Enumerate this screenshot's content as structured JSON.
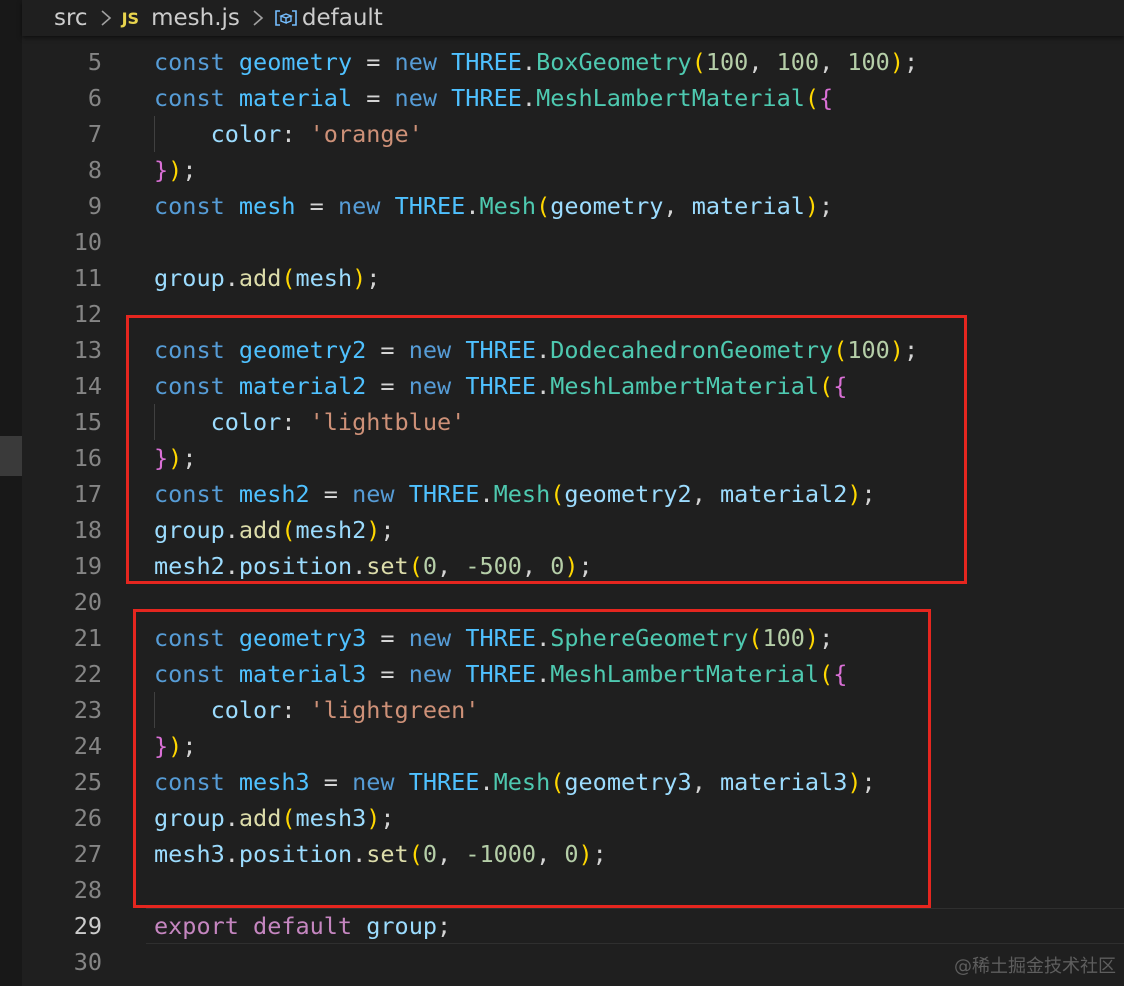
{
  "breadcrumb": {
    "folder": "src",
    "file_badge": "JS",
    "file": "mesh.js",
    "symbol": "default"
  },
  "editor": {
    "lines": [
      {
        "n": "5",
        "parts": [
          [
            "kw",
            "const"
          ],
          [
            "pun",
            " "
          ],
          [
            "var",
            "geometry"
          ],
          [
            "pun",
            " = "
          ],
          [
            "kw",
            "new"
          ],
          [
            "pun",
            " "
          ],
          [
            "var",
            "THREE"
          ],
          [
            "pun",
            "."
          ],
          [
            "cls",
            "BoxGeometry"
          ],
          [
            "b1",
            "("
          ],
          [
            "num",
            "100"
          ],
          [
            "pun",
            ", "
          ],
          [
            "num",
            "100"
          ],
          [
            "pun",
            ", "
          ],
          [
            "num",
            "100"
          ],
          [
            "b1",
            ")"
          ],
          [
            "pun",
            ";"
          ]
        ]
      },
      {
        "n": "6",
        "parts": [
          [
            "kw",
            "const"
          ],
          [
            "pun",
            " "
          ],
          [
            "var",
            "material"
          ],
          [
            "pun",
            " = "
          ],
          [
            "kw",
            "new"
          ],
          [
            "pun",
            " "
          ],
          [
            "var",
            "THREE"
          ],
          [
            "pun",
            "."
          ],
          [
            "cls",
            "MeshLambertMaterial"
          ],
          [
            "b1",
            "("
          ],
          [
            "b2",
            "{"
          ]
        ]
      },
      {
        "n": "7",
        "indent": true,
        "parts": [
          [
            "pun",
            "    "
          ],
          [
            "prop",
            "color"
          ],
          [
            "pun",
            ": "
          ],
          [
            "str",
            "'orange'"
          ]
        ]
      },
      {
        "n": "8",
        "parts": [
          [
            "b2",
            "}"
          ],
          [
            "b1",
            ")"
          ],
          [
            "pun",
            ";"
          ]
        ]
      },
      {
        "n": "9",
        "parts": [
          [
            "kw",
            "const"
          ],
          [
            "pun",
            " "
          ],
          [
            "var",
            "mesh"
          ],
          [
            "pun",
            " = "
          ],
          [
            "kw",
            "new"
          ],
          [
            "pun",
            " "
          ],
          [
            "var",
            "THREE"
          ],
          [
            "pun",
            "."
          ],
          [
            "cls",
            "Mesh"
          ],
          [
            "b1",
            "("
          ],
          [
            "prop",
            "geometry"
          ],
          [
            "pun",
            ", "
          ],
          [
            "prop",
            "material"
          ],
          [
            "b1",
            ")"
          ],
          [
            "pun",
            ";"
          ]
        ]
      },
      {
        "n": "10",
        "parts": []
      },
      {
        "n": "11",
        "parts": [
          [
            "prop",
            "group"
          ],
          [
            "pun",
            "."
          ],
          [
            "fn",
            "add"
          ],
          [
            "b1",
            "("
          ],
          [
            "prop",
            "mesh"
          ],
          [
            "b1",
            ")"
          ],
          [
            "pun",
            ";"
          ]
        ]
      },
      {
        "n": "12",
        "parts": []
      },
      {
        "n": "13",
        "parts": [
          [
            "kw",
            "const"
          ],
          [
            "pun",
            " "
          ],
          [
            "var",
            "geometry2"
          ],
          [
            "pun",
            " = "
          ],
          [
            "kw",
            "new"
          ],
          [
            "pun",
            " "
          ],
          [
            "var",
            "THREE"
          ],
          [
            "pun",
            "."
          ],
          [
            "cls",
            "DodecahedronGeometry"
          ],
          [
            "b1",
            "("
          ],
          [
            "num",
            "100"
          ],
          [
            "b1",
            ")"
          ],
          [
            "pun",
            ";"
          ]
        ]
      },
      {
        "n": "14",
        "parts": [
          [
            "kw",
            "const"
          ],
          [
            "pun",
            " "
          ],
          [
            "var",
            "material2"
          ],
          [
            "pun",
            " = "
          ],
          [
            "kw",
            "new"
          ],
          [
            "pun",
            " "
          ],
          [
            "var",
            "THREE"
          ],
          [
            "pun",
            "."
          ],
          [
            "cls",
            "MeshLambertMaterial"
          ],
          [
            "b1",
            "("
          ],
          [
            "b2",
            "{"
          ]
        ]
      },
      {
        "n": "15",
        "indent": true,
        "parts": [
          [
            "pun",
            "    "
          ],
          [
            "prop",
            "color"
          ],
          [
            "pun",
            ": "
          ],
          [
            "str",
            "'lightblue'"
          ]
        ]
      },
      {
        "n": "16",
        "parts": [
          [
            "b2",
            "}"
          ],
          [
            "b1",
            ")"
          ],
          [
            "pun",
            ";"
          ]
        ]
      },
      {
        "n": "17",
        "parts": [
          [
            "kw",
            "const"
          ],
          [
            "pun",
            " "
          ],
          [
            "var",
            "mesh2"
          ],
          [
            "pun",
            " = "
          ],
          [
            "kw",
            "new"
          ],
          [
            "pun",
            " "
          ],
          [
            "var",
            "THREE"
          ],
          [
            "pun",
            "."
          ],
          [
            "cls",
            "Mesh"
          ],
          [
            "b1",
            "("
          ],
          [
            "prop",
            "geometry2"
          ],
          [
            "pun",
            ", "
          ],
          [
            "prop",
            "material2"
          ],
          [
            "b1",
            ")"
          ],
          [
            "pun",
            ";"
          ]
        ]
      },
      {
        "n": "18",
        "parts": [
          [
            "prop",
            "group"
          ],
          [
            "pun",
            "."
          ],
          [
            "fn",
            "add"
          ],
          [
            "b1",
            "("
          ],
          [
            "prop",
            "mesh2"
          ],
          [
            "b1",
            ")"
          ],
          [
            "pun",
            ";"
          ]
        ]
      },
      {
        "n": "19",
        "parts": [
          [
            "prop",
            "mesh2"
          ],
          [
            "pun",
            "."
          ],
          [
            "prop",
            "position"
          ],
          [
            "pun",
            "."
          ],
          [
            "fn",
            "set"
          ],
          [
            "b1",
            "("
          ],
          [
            "num",
            "0"
          ],
          [
            "pun",
            ", "
          ],
          [
            "num",
            "-500"
          ],
          [
            "pun",
            ", "
          ],
          [
            "num",
            "0"
          ],
          [
            "b1",
            ")"
          ],
          [
            "pun",
            ";"
          ]
        ]
      },
      {
        "n": "20",
        "parts": []
      },
      {
        "n": "21",
        "parts": [
          [
            "kw",
            "const"
          ],
          [
            "pun",
            " "
          ],
          [
            "var",
            "geometry3"
          ],
          [
            "pun",
            " = "
          ],
          [
            "kw",
            "new"
          ],
          [
            "pun",
            " "
          ],
          [
            "var",
            "THREE"
          ],
          [
            "pun",
            "."
          ],
          [
            "cls",
            "SphereGeometry"
          ],
          [
            "b1",
            "("
          ],
          [
            "num",
            "100"
          ],
          [
            "b1",
            ")"
          ],
          [
            "pun",
            ";"
          ]
        ]
      },
      {
        "n": "22",
        "parts": [
          [
            "kw",
            "const"
          ],
          [
            "pun",
            " "
          ],
          [
            "var",
            "material3"
          ],
          [
            "pun",
            " = "
          ],
          [
            "kw",
            "new"
          ],
          [
            "pun",
            " "
          ],
          [
            "var",
            "THREE"
          ],
          [
            "pun",
            "."
          ],
          [
            "cls",
            "MeshLambertMaterial"
          ],
          [
            "b1",
            "("
          ],
          [
            "b2",
            "{"
          ]
        ]
      },
      {
        "n": "23",
        "indent": true,
        "parts": [
          [
            "pun",
            "    "
          ],
          [
            "prop",
            "color"
          ],
          [
            "pun",
            ": "
          ],
          [
            "str",
            "'lightgreen'"
          ]
        ]
      },
      {
        "n": "24",
        "parts": [
          [
            "b2",
            "}"
          ],
          [
            "b1",
            ")"
          ],
          [
            "pun",
            ";"
          ]
        ]
      },
      {
        "n": "25",
        "parts": [
          [
            "kw",
            "const"
          ],
          [
            "pun",
            " "
          ],
          [
            "var",
            "mesh3"
          ],
          [
            "pun",
            " = "
          ],
          [
            "kw",
            "new"
          ],
          [
            "pun",
            " "
          ],
          [
            "var",
            "THREE"
          ],
          [
            "pun",
            "."
          ],
          [
            "cls",
            "Mesh"
          ],
          [
            "b1",
            "("
          ],
          [
            "prop",
            "geometry3"
          ],
          [
            "pun",
            ", "
          ],
          [
            "prop",
            "material3"
          ],
          [
            "b1",
            ")"
          ],
          [
            "pun",
            ";"
          ]
        ]
      },
      {
        "n": "26",
        "parts": [
          [
            "prop",
            "group"
          ],
          [
            "pun",
            "."
          ],
          [
            "fn",
            "add"
          ],
          [
            "b1",
            "("
          ],
          [
            "prop",
            "mesh3"
          ],
          [
            "b1",
            ")"
          ],
          [
            "pun",
            ";"
          ]
        ]
      },
      {
        "n": "27",
        "parts": [
          [
            "prop",
            "mesh3"
          ],
          [
            "pun",
            "."
          ],
          [
            "prop",
            "position"
          ],
          [
            "pun",
            "."
          ],
          [
            "fn",
            "set"
          ],
          [
            "b1",
            "("
          ],
          [
            "num",
            "0"
          ],
          [
            "pun",
            ", "
          ],
          [
            "num",
            "-1000"
          ],
          [
            "pun",
            ", "
          ],
          [
            "num",
            "0"
          ],
          [
            "b1",
            ")"
          ],
          [
            "pun",
            ";"
          ]
        ]
      },
      {
        "n": "28",
        "parts": []
      },
      {
        "n": "29",
        "active": true,
        "parts": [
          [
            "ctrl",
            "export"
          ],
          [
            "pun",
            " "
          ],
          [
            "ctrl",
            "default"
          ],
          [
            "pun",
            " "
          ],
          [
            "prop",
            "group"
          ],
          [
            "pun",
            ";"
          ]
        ]
      },
      {
        "n": "30",
        "parts": []
      }
    ]
  },
  "colors": {
    "highlight_box": "#e5261f",
    "keyword": "#569cd6",
    "class": "#4ec9b0",
    "string": "#ce9178",
    "number": "#b5cea8"
  },
  "watermark": "@稀土掘金技术社区"
}
